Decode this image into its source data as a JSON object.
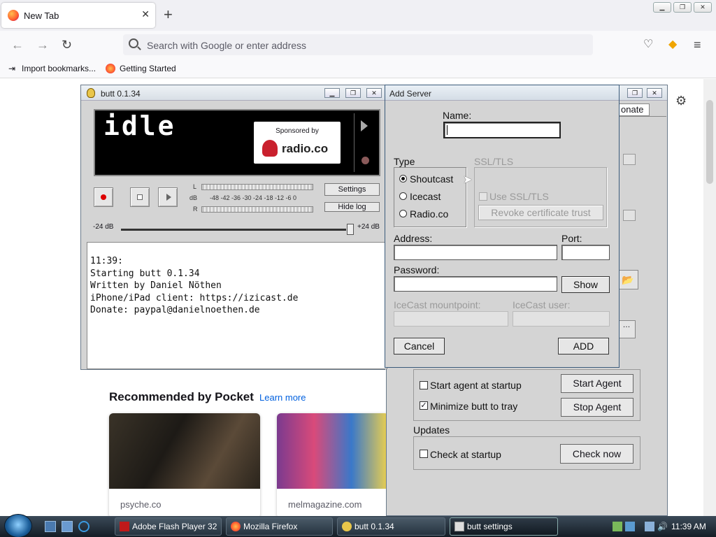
{
  "browser": {
    "tab_title": "New Tab",
    "new_tab_symbol": "+",
    "url_placeholder": "Search with Google or enter address",
    "bookmarks": [
      "Import bookmarks...",
      "Getting Started"
    ],
    "window_controls": [
      "minimize",
      "restore",
      "close"
    ]
  },
  "pocket": {
    "title": "Recommended by Pocket",
    "learn_more": "Learn more",
    "cards": [
      {
        "source": "psyche.co"
      },
      {
        "source": "melmagazine.com"
      }
    ]
  },
  "butt": {
    "title": "butt 0.1.34",
    "status": "idle",
    "sponsor_caption": "Sponsored by",
    "sponsor_brand": "radio.co",
    "vu": {
      "left_label": "L",
      "db_label": "dB",
      "right_label": "R",
      "scale": "-48 -42 -36 -30 -24 -18 -12 -6 0"
    },
    "settings_button": "Settings",
    "hide_log_button": "Hide log",
    "gain_min": "-24 dB",
    "gain_max": "+24 dB",
    "log": "11:39:\nStarting butt 0.1.34\nWritten by Daniel Nöthen\niPhone/iPad client: https://izicast.de\nDonate: paypal@danielnoethen.de"
  },
  "settings": {
    "donate_tab": "onate",
    "start_agent_label": "Start agent at startup",
    "start_agent_checked": false,
    "minimize_label": "Minimize butt to tray",
    "minimize_checked": true,
    "start_agent_button": "Start Agent",
    "stop_agent_button": "Stop Agent",
    "updates_heading": "Updates",
    "check_startup_label": "Check at startup",
    "check_startup_checked": false,
    "check_now_button": "Check now"
  },
  "add_server": {
    "title": "Add Server",
    "name_label": "Name:",
    "name_value": "",
    "type_label": "Type",
    "types": [
      "Shoutcast",
      "Icecast",
      "Radio.co"
    ],
    "selected_type": "Shoutcast",
    "ssl_label": "SSL/TLS",
    "use_ssl_label": "Use SSL/TLS",
    "revoke_button": "Revoke certificate trust",
    "address_label": "Address:",
    "port_label": "Port:",
    "password_label": "Password:",
    "show_button": "Show",
    "mountpoint_label": "IceCast mountpoint:",
    "icecast_user_label": "IceCast user:",
    "cancel_button": "Cancel",
    "add_button": "ADD"
  },
  "taskbar": {
    "items": [
      "Adobe Flash Player 32",
      "Mozilla Firefox",
      "butt 0.1.34",
      "butt settings"
    ],
    "active": "butt settings",
    "clock": "11:39 AM"
  }
}
